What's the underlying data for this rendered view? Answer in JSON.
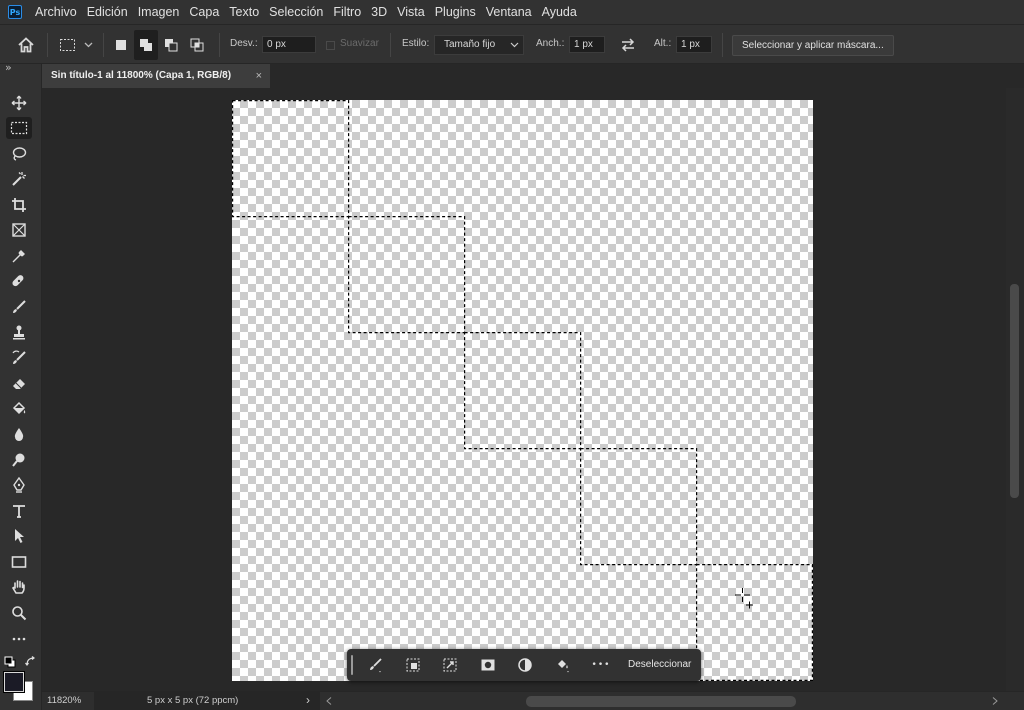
{
  "menubar": {
    "logo": "Ps",
    "items": [
      "Archivo",
      "Edición",
      "Imagen",
      "Capa",
      "Texto",
      "Selección",
      "Filtro",
      "3D",
      "Vista",
      "Plugins",
      "Ventana",
      "Ayuda"
    ]
  },
  "options": {
    "feather_label": "Desv.:",
    "feather_value": "0 px",
    "antialias_label": "Suavizar",
    "style_label": "Estilo:",
    "style_value": "Tamaño fijo",
    "width_label": "Anch.:",
    "width_value": "1 px",
    "height_label": "Alt.:",
    "height_value": "1 px",
    "select_mask_button": "Seleccionar y aplicar máscara..."
  },
  "document_tab": {
    "title": "Sin título-1 al 11800% (Capa 1, RGB/8)",
    "close": "×"
  },
  "toolbar": {
    "collapse": "»",
    "tools": [
      "move",
      "rectangular-marquee",
      "lasso",
      "magic-wand",
      "crop",
      "frame",
      "eyedropper",
      "spot-healing",
      "brush",
      "clone-stamp",
      "history-brush",
      "eraser",
      "paint-bucket",
      "blur",
      "dodge",
      "pen",
      "type",
      "path-selection",
      "rectangle",
      "hand",
      "zoom",
      "more"
    ]
  },
  "contextual_taskbar": {
    "deselect": "Deseleccionar",
    "more": "•••"
  },
  "status": {
    "zoom": "11820%",
    "doc_info": "5 px x 5 px (72 ppcm)",
    "arrow": "›"
  },
  "colors": {
    "foreground": "#1b1b26",
    "background": "#ffffff"
  }
}
